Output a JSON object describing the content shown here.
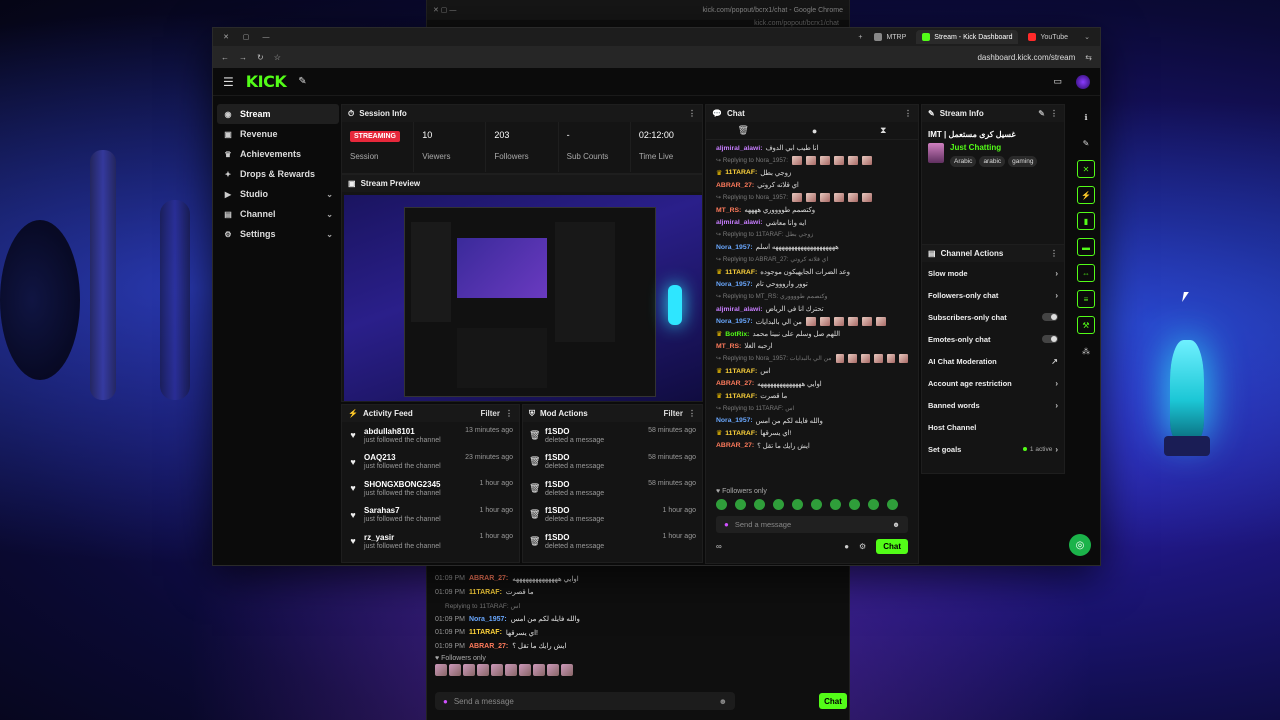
{
  "back_window": {
    "title": "kick.com/popout/bcrx1/chat - Google Chrome",
    "url": "kick.com/popout/bcrx1/chat",
    "messages": [
      {
        "time": "01:09 PM",
        "user": "ABRAR_27:",
        "text": "اوايي ههههههههههههههه",
        "color": "#ff7b5c",
        "reply": ""
      },
      {
        "time": "01:09 PM",
        "user": "11TARAF:",
        "text": "ما قصرت",
        "color": "#ffd43b",
        "reply": ""
      },
      {
        "time": "",
        "user": "",
        "text": "Replying to 11TARAF: اس",
        "color": "#888",
        "reply": "yes"
      },
      {
        "time": "01:09 PM",
        "user": "Nora_1957:",
        "text": "والله فايله لكم من امس",
        "color": "#6aa8ff",
        "reply": ""
      },
      {
        "time": "01:09 PM",
        "user": "11TARAF:",
        "text": "اي يسرقها!",
        "color": "#ffd43b",
        "reply": ""
      },
      {
        "time": "01:09 PM",
        "user": "ABRAR_27:",
        "text": "ايش رايك ما تقل ؟",
        "color": "#ff7b5c",
        "reply": ""
      }
    ],
    "followers_only": "Followers only",
    "input_placeholder": "Send a message",
    "chat_button": "Chat"
  },
  "browser": {
    "tabs": [
      {
        "label": "MTRP",
        "active": false,
        "color": "#888"
      },
      {
        "label": "Stream - Kick Dashboard",
        "active": true,
        "color": "#53fc18"
      },
      {
        "label": "YouTube",
        "active": false,
        "color": "#ff2a2a"
      }
    ],
    "url": "dashboard.kick.com/stream"
  },
  "app": {
    "logo": "KICK"
  },
  "sidebar": {
    "items": [
      {
        "label": "Stream",
        "icon": "stream-icon",
        "glyph": "◉",
        "active": true,
        "chevron": false
      },
      {
        "label": "Revenue",
        "icon": "revenue-icon",
        "glyph": "▣",
        "active": false,
        "chevron": false
      },
      {
        "label": "Achievements",
        "icon": "trophy-icon",
        "glyph": "♛",
        "active": false,
        "chevron": false
      },
      {
        "label": "Drops & Rewards",
        "icon": "gift-icon",
        "glyph": "✦",
        "active": false,
        "chevron": false
      },
      {
        "label": "Studio",
        "icon": "studio-icon",
        "glyph": "▶",
        "active": false,
        "chevron": true
      },
      {
        "label": "Channel",
        "icon": "channel-icon",
        "glyph": "▤",
        "active": false,
        "chevron": true
      },
      {
        "label": "Settings",
        "icon": "gear-icon",
        "glyph": "⚙",
        "active": false,
        "chevron": true
      }
    ]
  },
  "session": {
    "title": "Session Info",
    "badge": "STREAMING",
    "stats": [
      {
        "value": "",
        "label": "Session"
      },
      {
        "value": "10",
        "label": "Viewers"
      },
      {
        "value": "203",
        "label": "Followers"
      },
      {
        "value": "-",
        "label": "Sub Counts"
      },
      {
        "value": "02:12:00",
        "label": "Time Live"
      }
    ]
  },
  "preview": {
    "title": "Stream Preview"
  },
  "activity": {
    "title": "Activity Feed",
    "filter": "Filter",
    "items": [
      {
        "name": "abdullah8101",
        "sub": "just followed the channel",
        "time": "13 minutes ago"
      },
      {
        "name": "OAQ213",
        "sub": "just followed the channel",
        "time": "23 minutes ago"
      },
      {
        "name": "SHONGXBONG2345",
        "sub": "just followed the channel",
        "time": "1 hour ago"
      },
      {
        "name": "Sarahas7",
        "sub": "just followed the channel",
        "time": "1 hour ago"
      },
      {
        "name": "rz_yasir",
        "sub": "just followed the channel",
        "time": "1 hour ago"
      }
    ]
  },
  "mod_actions": {
    "title": "Mod Actions",
    "filter": "Filter",
    "items": [
      {
        "name": "f1SDO",
        "sub": "deleted a message",
        "time": "58 minutes ago"
      },
      {
        "name": "f1SDO",
        "sub": "deleted a message",
        "time": "58 minutes ago"
      },
      {
        "name": "f1SDO",
        "sub": "deleted a message",
        "time": "58 minutes ago"
      },
      {
        "name": "f1SDO",
        "sub": "deleted a message",
        "time": "1 hour ago"
      },
      {
        "name": "f1SDO",
        "sub": "deleted a message",
        "time": "1 hour ago"
      }
    ]
  },
  "chat": {
    "title": "Chat",
    "messages": [
      {
        "reply": "",
        "user": "aljmiral_alawi:",
        "text": "انا طيب ابي الدوف",
        "color": "#c77dff",
        "emotes": 0
      },
      {
        "reply": "Replying to Nora_1957:",
        "user": "",
        "text": "",
        "color": "#777",
        "emotes": 6
      },
      {
        "reply": "",
        "user": "11TARAF:",
        "text": "زوجي بطل",
        "color": "#ffd43b",
        "emotes": 0
      },
      {
        "reply": "",
        "user": "ABRAR_27:",
        "text": "اي قلاته كروتي",
        "color": "#ff7b5c",
        "emotes": 0
      },
      {
        "reply": "Replying to Nora_1957:",
        "user": "",
        "text": "",
        "color": "#777",
        "emotes": 6
      },
      {
        "reply": "",
        "user": "MT_RS:",
        "text": "وكتصمم طووووري ههههه",
        "color": "#ff7b5c",
        "emotes": 0
      },
      {
        "reply": "",
        "user": "aljmiral_alawi:",
        "text": "ايه وانا معاشي",
        "color": "#c77dff",
        "emotes": 0
      },
      {
        "reply": "Replying to 11TARAF: زوجي بطل",
        "user": "",
        "text": "",
        "color": "#777",
        "emotes": 0
      },
      {
        "reply": "",
        "user": "Nora_1957:",
        "text": "ههههههههههههههههههههه اسلم",
        "color": "#6aa8ff",
        "emotes": 0
      },
      {
        "reply": "Replying to ABRAR_27: اي قلاته كروتي",
        "user": "",
        "text": "",
        "color": "#777",
        "emotes": 0
      },
      {
        "reply": "",
        "user": "11TARAF:",
        "text": "وعد الضرات الجايهيكون موجوده",
        "color": "#ffd43b",
        "emotes": 0
      },
      {
        "reply": "",
        "user": "Nora_1957:",
        "text": "توور واروووحي تام",
        "color": "#6aa8ff",
        "emotes": 0
      },
      {
        "reply": "Replying to MT_RS: وكتصمم طووووري",
        "user": "",
        "text": "",
        "color": "#777",
        "emotes": 0
      },
      {
        "reply": "",
        "user": "aljmiral_alawi:",
        "text": "تحترك انا في الرياض",
        "color": "#c77dff",
        "emotes": 0
      },
      {
        "reply": "",
        "user": "Nora_1957:",
        "text": "من الي بالبدايات",
        "color": "#6aa8ff",
        "emotes": 6
      },
      {
        "reply": "",
        "user": "BotRix:",
        "text": "اللهم صل وسلم على نبينا محمد",
        "color": "#53fc18",
        "emotes": 0
      },
      {
        "reply": "",
        "user": "MT_RS:",
        "text": "ارحبه الغلا",
        "color": "#ff7b5c",
        "emotes": 0
      },
      {
        "reply": "Replying to Nora_1957: من الي بالبدايات",
        "user": "",
        "text": "",
        "color": "#777",
        "emotes": 6
      },
      {
        "reply": "",
        "user": "11TARAF:",
        "text": "اس",
        "color": "#ffd43b",
        "emotes": 0
      },
      {
        "reply": "",
        "user": "ABRAR_27:",
        "text": "اوايي ههههههههههههههه",
        "color": "#ff7b5c",
        "emotes": 0
      },
      {
        "reply": "",
        "user": "11TARAF:",
        "text": "ما قصرت",
        "color": "#ffd43b",
        "emotes": 0
      },
      {
        "reply": "Replying to 11TARAF: اس",
        "user": "",
        "text": "",
        "color": "#777",
        "emotes": 0
      },
      {
        "reply": "",
        "user": "Nora_1957:",
        "text": "والله فايله لكم من امس",
        "color": "#6aa8ff",
        "emotes": 0
      },
      {
        "reply": "",
        "user": "11TARAF:",
        "text": "اي يسرقها!",
        "color": "#ffd43b",
        "emotes": 0
      },
      {
        "reply": "",
        "user": "ABRAR_27:",
        "text": "ايش رايك ما تقل ؟",
        "color": "#ff7b5c",
        "emotes": 0
      }
    ],
    "followers_only": "Followers only",
    "input_placeholder": "Send a message",
    "chat_button": "Chat"
  },
  "stream_info": {
    "title": "Stream Info",
    "stream_title": "IMT | غسيل كرى مستعمل",
    "category": "Just Chatting",
    "tags": [
      "Arabic",
      "arabic",
      "gaming"
    ]
  },
  "channel_actions": {
    "title": "Channel Actions",
    "items": [
      {
        "label": "Slow mode",
        "control": "chevron",
        "extra": ""
      },
      {
        "label": "Followers-only chat",
        "control": "chevron",
        "extra": ""
      },
      {
        "label": "Subscribers-only chat",
        "control": "toggle",
        "extra": ""
      },
      {
        "label": "Emotes-only chat",
        "control": "toggle",
        "extra": ""
      },
      {
        "label": "AI Chat Moderation",
        "control": "external",
        "extra": ""
      },
      {
        "label": "Account age restriction",
        "control": "chevron",
        "extra": ""
      },
      {
        "label": "Banned words",
        "control": "chevron",
        "extra": ""
      },
      {
        "label": "Host Channel",
        "control": "none",
        "extra": ""
      },
      {
        "label": "Set goals",
        "control": "chevron",
        "extra": "1 active"
      }
    ]
  }
}
